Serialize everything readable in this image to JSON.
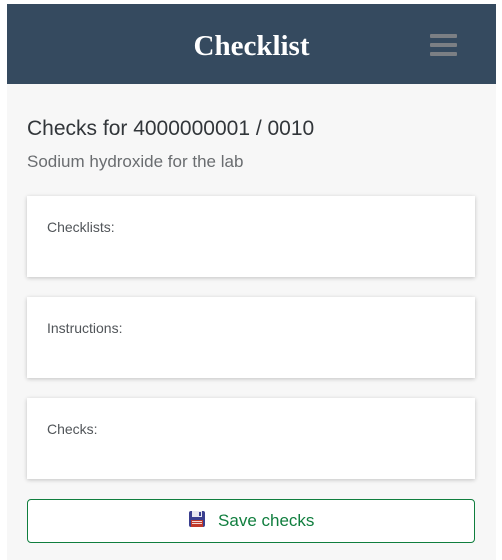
{
  "header": {
    "title": "Checklist",
    "menu_icon": "hamburger-menu-icon"
  },
  "page": {
    "title": "Checks for 4000000001 / 0010",
    "subtitle": "Sodium hydroxide for the lab"
  },
  "panels": [
    {
      "label": "Checklists:"
    },
    {
      "label": "Instructions:"
    },
    {
      "label": "Checks:"
    }
  ],
  "save_button": {
    "label": "Save checks",
    "icon": "floppy-disk-icon"
  },
  "colors": {
    "header_bg": "#354a5f",
    "page_bg": "#f7f7f7",
    "accent_green": "#107e3e",
    "panel_bg": "#ffffff"
  }
}
